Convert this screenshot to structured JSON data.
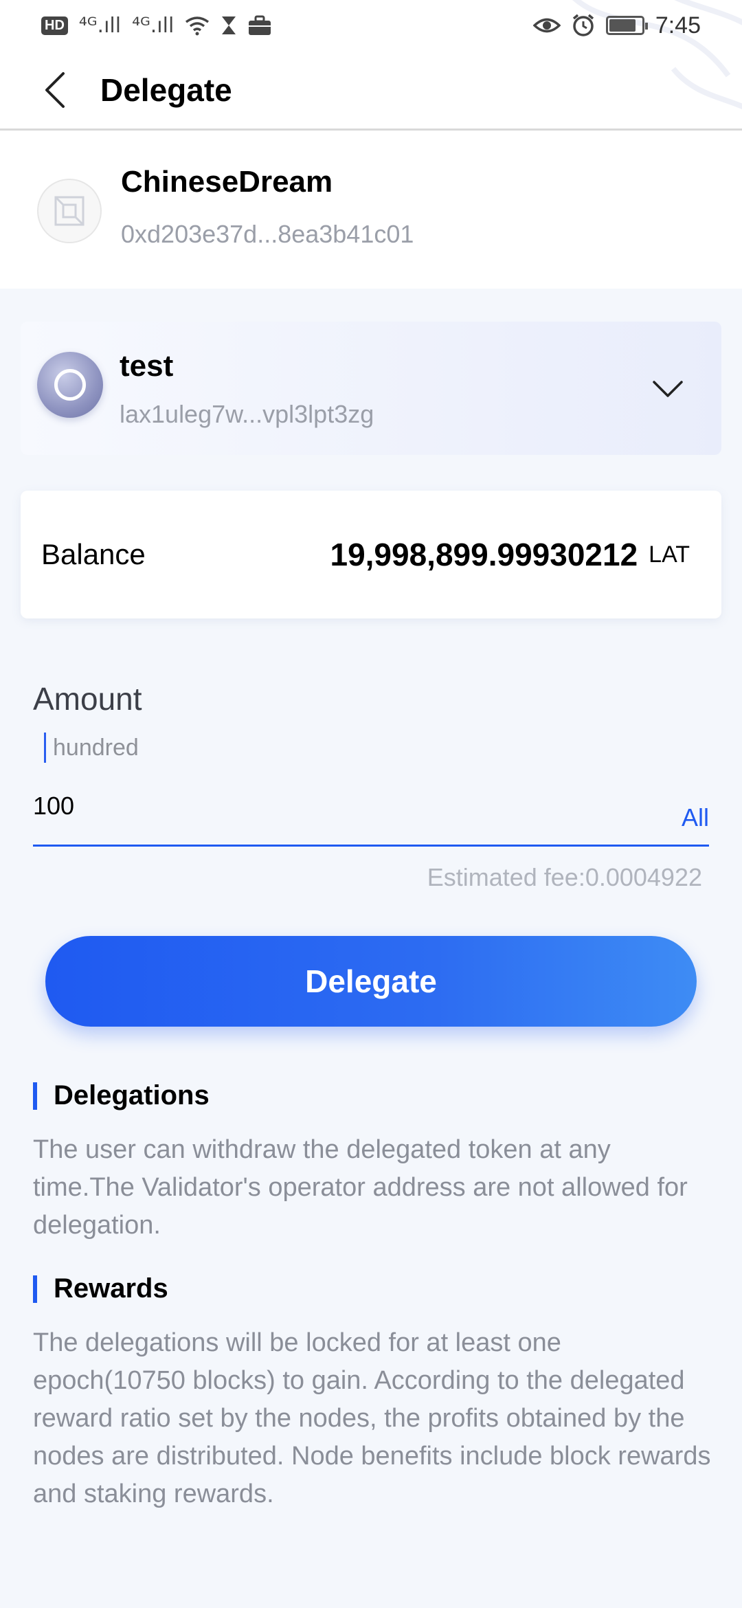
{
  "status_bar": {
    "left_icons": [
      "hd-icon",
      "signal-4g-icon",
      "signal-4g-icon",
      "wifi-icon",
      "hourglass-icon",
      "briefcase-icon"
    ],
    "hd_label": "HD",
    "signal1": "⁴ᴳ.ıll",
    "signal2": "⁴ᴳ.ıll",
    "time": "7:45",
    "battery_level": 0.85
  },
  "nav": {
    "title": "Delegate"
  },
  "validator": {
    "name": "ChineseDream",
    "address": "0xd203e37d...8ea3b41c01"
  },
  "wallet": {
    "name": "test",
    "address": "lax1uleg7w...vpl3lpt3zg"
  },
  "balance": {
    "label": "Balance",
    "value": "19,998,899.99930212",
    "unit": "LAT"
  },
  "amount": {
    "label": "Amount",
    "hint": "hundred",
    "value": "100",
    "all_label": "All"
  },
  "fee": "Estimated fee:0.0004922",
  "delegate_button": "Delegate",
  "sections": [
    {
      "title": "Delegations",
      "body": "The user can withdraw the delegated token at any time.The Validator's operator address are not allowed for delegation."
    },
    {
      "title": "Rewards",
      "body": "The delegations will be locked for at least one epoch(10750 blocks) to gain. According to the delegated reward ratio set by the nodes, the profits obtained by the nodes are distributed. Node benefits include block rewards and staking rewards."
    }
  ],
  "colors": {
    "accent": "#1f5af1",
    "background": "#f4f7fc",
    "muted_text": "#8a8e98"
  }
}
